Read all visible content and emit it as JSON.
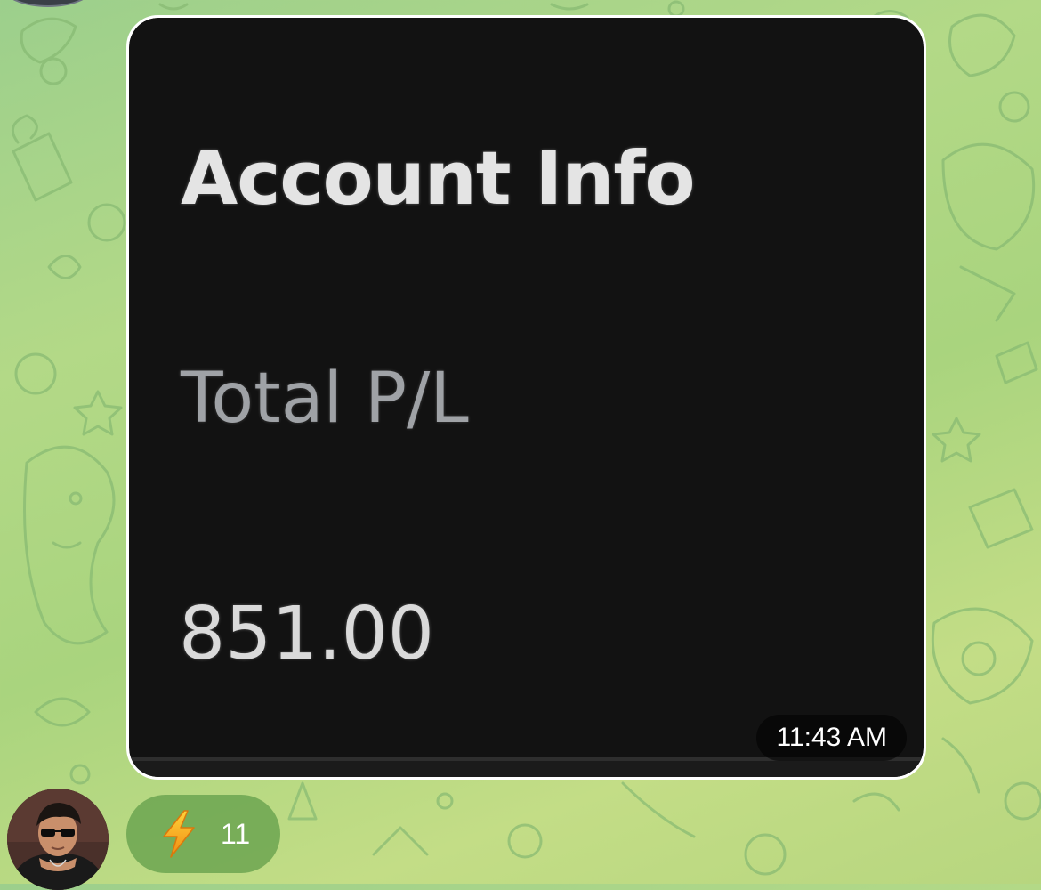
{
  "message": {
    "image": {
      "title": "Account Info",
      "label": "Total P/L",
      "value": "851.00"
    },
    "timestamp": "11:43 AM"
  },
  "reaction": {
    "emoji": "lightning-icon",
    "count": "11"
  },
  "colors": {
    "chat_background": "#b3d987",
    "doodle_stroke": "#8fc07a",
    "image_background": "#121212",
    "reaction_pill": "#629e4a",
    "lightning": "#f6a623"
  }
}
